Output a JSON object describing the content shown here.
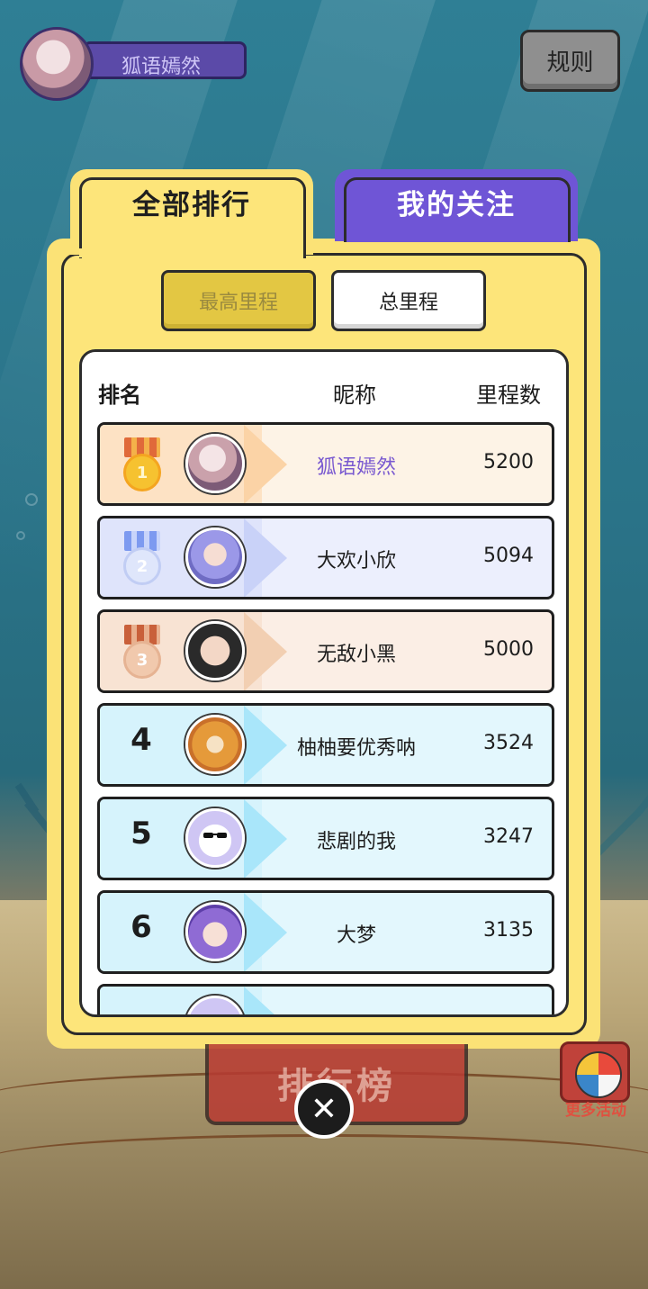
{
  "user": {
    "name": "狐语嫣然"
  },
  "top": {
    "rules_label": "规则"
  },
  "tabs": [
    {
      "label": "全部排行",
      "active": true
    },
    {
      "label": "我的关注",
      "active": false
    }
  ],
  "segments": [
    {
      "label": "最高里程",
      "active": true
    },
    {
      "label": "总里程",
      "active": false
    }
  ],
  "board": {
    "headers": {
      "rank": "排名",
      "nickname": "昵称",
      "distance": "里程数"
    },
    "rows": [
      {
        "rank": "1",
        "name": "狐语嫣然",
        "score": "5200"
      },
      {
        "rank": "2",
        "name": "大欢小欣",
        "score": "5094"
      },
      {
        "rank": "3",
        "name": "无敌小黑",
        "score": "5000"
      },
      {
        "rank": "4",
        "name": "柚柚要优秀呐",
        "score": "3524"
      },
      {
        "rank": "5",
        "name": "悲剧的我",
        "score": "3247"
      },
      {
        "rank": "6",
        "name": "大梦",
        "score": "3135"
      }
    ]
  },
  "bottom": {
    "leaderboard_label": "排行榜",
    "more_label": "更多活动"
  },
  "colors": {
    "accent_purple": "#6f55d6",
    "panel_yellow": "#fde57a",
    "highlight_name": "#7a5ad0"
  }
}
